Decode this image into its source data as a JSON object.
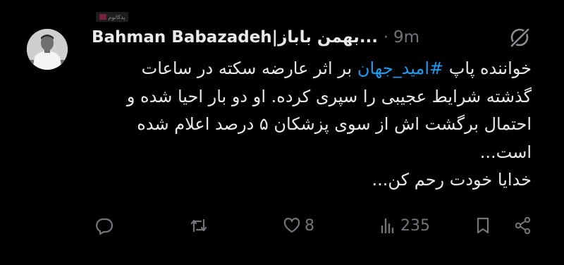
{
  "tweet": {
    "display_name": "Bahman Babazadeh|بهمن باباز...",
    "separator": "·",
    "time": "9m",
    "body": {
      "line1_prefix": "خواننده پاپ",
      "hashtag": "#امید_جهان",
      "line1_suffix": "بر اثر عارضه سکته در ساعات",
      "line2": "گذشته شرایط عجیبی را سپری کرده. او دو بار احیا شده و",
      "line3": "احتمال برگشت اش از سوی پزشکان ۵ درصد اعلام شده",
      "line4": "است...",
      "line5": "خدایا خودت رحم کن..."
    },
    "actions": {
      "like_count": "8",
      "views_count": "235"
    }
  },
  "watermark": {
    "label": "پدکاتوم"
  },
  "icons": {
    "header": "grok-icon",
    "reply": "reply-icon",
    "retweet": "retweet-icon",
    "like": "heart-icon",
    "views": "views-icon",
    "bookmark": "bookmark-icon",
    "share": "share-icon"
  },
  "colors": {
    "background": "#000000",
    "text": "#e7e9ea",
    "secondary": "#71767b",
    "link": "#1d9bf0"
  }
}
